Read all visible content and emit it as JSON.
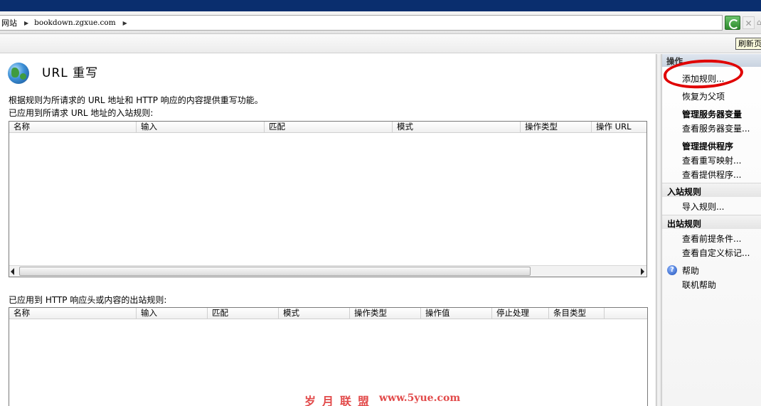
{
  "breadcrumb": {
    "root": "网站",
    "host": "bookdown.zgxue.com"
  },
  "menustrip": {
    "refresh_tooltip": "刷新页"
  },
  "main": {
    "title": "URL 重写",
    "description": "根据规则为所请求的 URL 地址和 HTTP 响应的内容提供重写功能。",
    "inbound_caption": "已应用到所请求 URL 地址的入站规则:",
    "inbound_columns": [
      "名称",
      "输入",
      "匹配",
      "模式",
      "操作类型",
      "操作 URL"
    ],
    "outbound_caption": "已应用到 HTTP 响应头或内容的出站规则:",
    "outbound_columns": [
      "名称",
      "输入",
      "匹配",
      "模式",
      "操作类型",
      "操作值",
      "停止处理",
      "条目类型"
    ]
  },
  "actions": {
    "header": "操作",
    "add_rule": "添加规则...",
    "revert_parent": "恢复为父项",
    "manage_server_vars": "管理服务器变量",
    "view_server_vars": "查看服务器变量...",
    "manage_providers": "管理提供程序",
    "view_rewrite_maps": "查看重写映射...",
    "view_providers": "查看提供程序...",
    "inbound_section": "入站规则",
    "import_rules": "导入规则...",
    "outbound_section": "出站规则",
    "view_preconditions": "查看前提条件...",
    "view_custom_tags": "查看自定义标记...",
    "help": "帮助",
    "online_help": "联机帮助"
  },
  "watermark": {
    "text": "岁月联盟",
    "url": "www.5yue.com"
  },
  "colors": {
    "title_bar": "#0a2e6e",
    "annotation_red": "#e00000",
    "watermark": "#e24a4a"
  }
}
